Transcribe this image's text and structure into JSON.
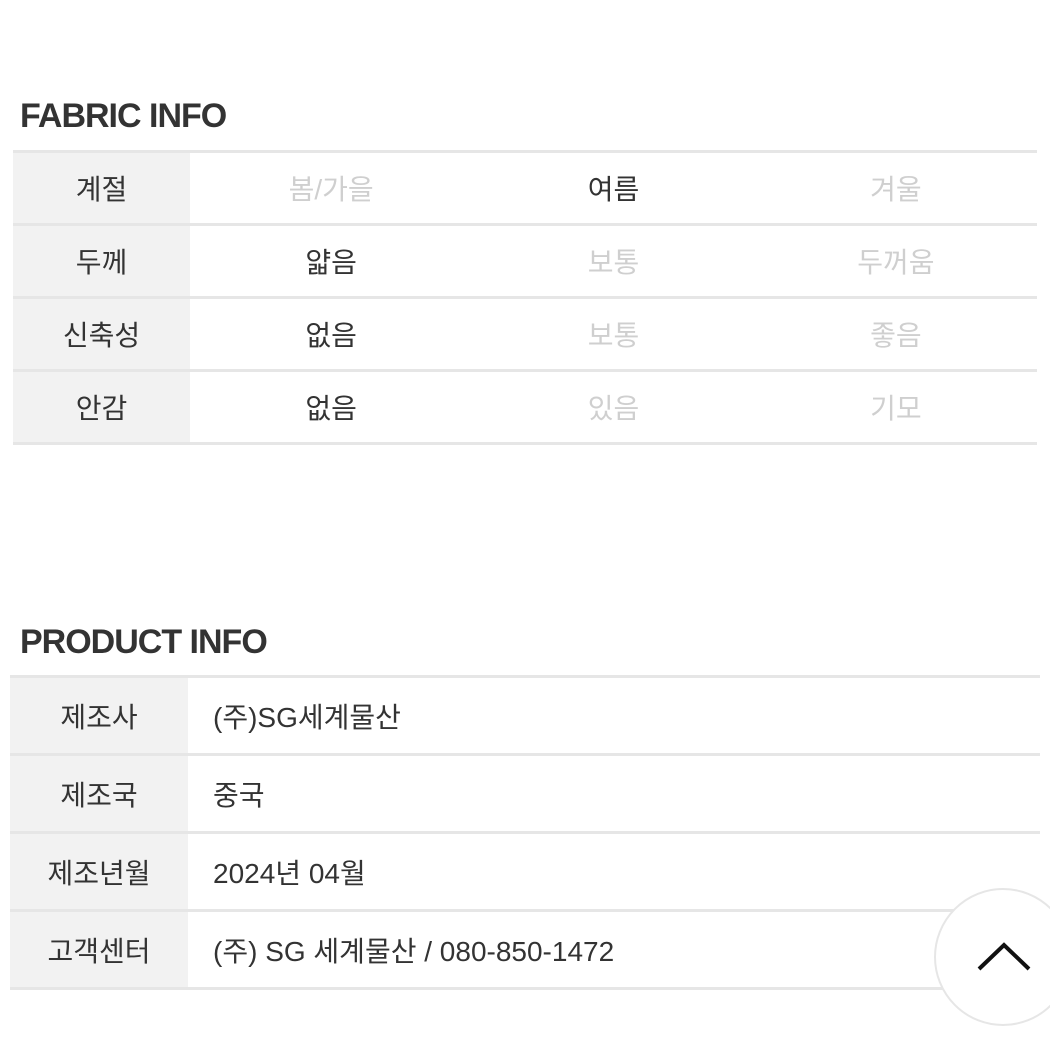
{
  "fabric_info": {
    "title": "FABRIC INFO",
    "rows": [
      {
        "label": "계절",
        "options": [
          {
            "text": "봄/가을",
            "selected": false
          },
          {
            "text": "여름",
            "selected": true
          },
          {
            "text": "겨울",
            "selected": false
          }
        ]
      },
      {
        "label": "두께",
        "options": [
          {
            "text": "얇음",
            "selected": true
          },
          {
            "text": "보통",
            "selected": false
          },
          {
            "text": "두꺼움",
            "selected": false
          }
        ]
      },
      {
        "label": "신축성",
        "options": [
          {
            "text": "없음",
            "selected": true
          },
          {
            "text": "보통",
            "selected": false
          },
          {
            "text": "좋음",
            "selected": false
          }
        ]
      },
      {
        "label": "안감",
        "options": [
          {
            "text": "없음",
            "selected": true
          },
          {
            "text": "있음",
            "selected": false
          },
          {
            "text": "기모",
            "selected": false
          }
        ]
      }
    ]
  },
  "product_info": {
    "title": "PRODUCT INFO",
    "rows": [
      {
        "label": "제조사",
        "value": "(주)SG세계물산"
      },
      {
        "label": "제조국",
        "value": "중국"
      },
      {
        "label": "제조년월",
        "value": "2024년 04월"
      },
      {
        "label": "고객센터",
        "value": "(주) SG 세계물산 / 080-850-1472"
      }
    ]
  },
  "scroll_top_button": {
    "icon": "chevron-up-icon"
  }
}
